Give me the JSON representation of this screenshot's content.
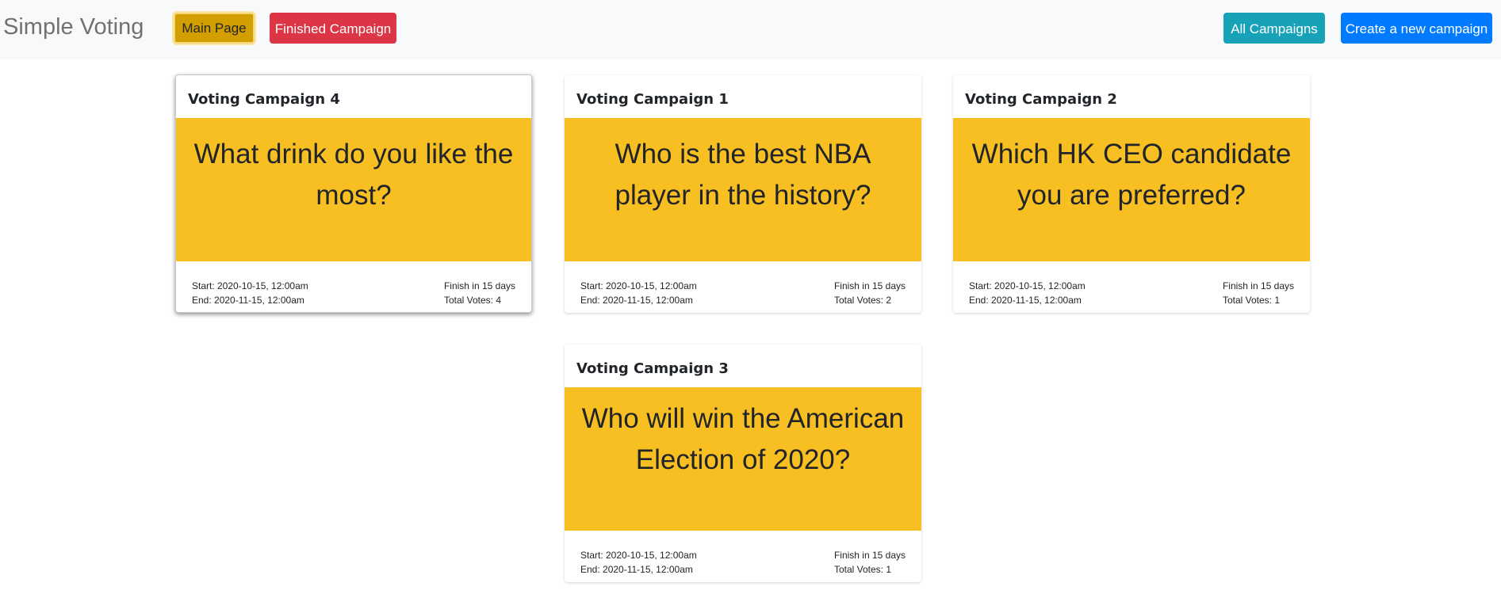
{
  "header": {
    "brand": "Simple Voting",
    "main_page_label": "Main Page",
    "finished_campaign_label": "Finished Campaign",
    "all_campaigns_label": "All Campaigns",
    "create_campaign_label": "Create a new campaign"
  },
  "colors": {
    "navbar_bg": "#f8f9fa",
    "card_body": "#f8bf22",
    "main_button": "#d39e00",
    "finished_button": "#dc3545",
    "all_button": "#17a2b8",
    "create_button": "#007bff"
  },
  "campaigns": [
    {
      "title": "Voting Campaign 4",
      "question": "What drink do you like the most?",
      "start": "Start: 2020-10-15, 12:00am",
      "end": "End: 2020-11-15, 12:00am",
      "finish": "Finish in 15 days",
      "votes": "Total Votes: 4"
    },
    {
      "title": "Voting Campaign 1",
      "question": "Who is the best NBA player in the history?",
      "start": "Start: 2020-10-15, 12:00am",
      "end": "End: 2020-11-15, 12:00am",
      "finish": "Finish in 15 days",
      "votes": "Total Votes: 2"
    },
    {
      "title": "Voting Campaign 2",
      "question": "Which HK CEO candidate you are preferred?",
      "start": "Start: 2020-10-15, 12:00am",
      "end": "End: 2020-11-15, 12:00am",
      "finish": "Finish in 15 days",
      "votes": "Total Votes: 1"
    },
    {
      "title": "Voting Campaign 3",
      "question": "Who will win the American Election of 2020?",
      "start": "Start: 2020-10-15, 12:00am",
      "end": "End: 2020-11-15, 12:00am",
      "finish": "Finish in 15 days",
      "votes": "Total Votes: 1"
    }
  ]
}
